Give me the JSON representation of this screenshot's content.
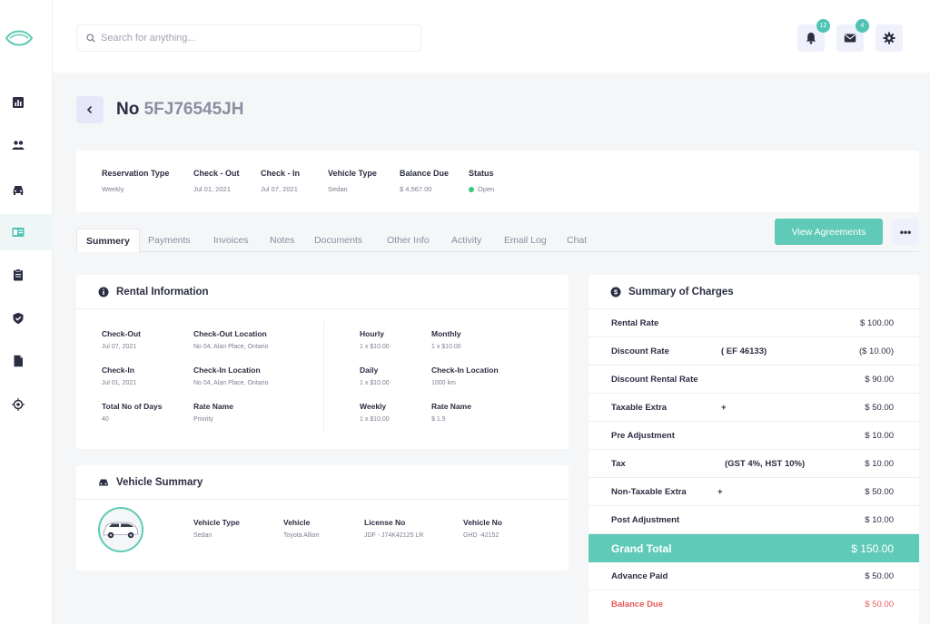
{
  "search": {
    "placeholder": "Search for anything..."
  },
  "notifications": {
    "bell_count": "12",
    "mail_count": "4"
  },
  "title": {
    "prefix": "No",
    "id": "5FJ76545JH"
  },
  "info": [
    {
      "label": "Reservation Type",
      "value": "Weekly"
    },
    {
      "label": "Check - Out",
      "value": "Jul 01, 2021"
    },
    {
      "label": "Check - In",
      "value": "Jul 07, 2021"
    },
    {
      "label": "Vehicle Type",
      "value": "Sedan"
    },
    {
      "label": "Balance Due",
      "value": "$ 4,567.00"
    },
    {
      "label": "Status",
      "value": "Open"
    }
  ],
  "tabs": [
    "Summery",
    "Payments",
    "Invoices",
    "Notes",
    "Documents",
    "Other Info",
    "Activity",
    "Email Log",
    "Chat"
  ],
  "actions": {
    "view_agreements": "View Agreements",
    "more": "•••"
  },
  "rental": {
    "title": "Rental Information",
    "fields": [
      {
        "label": "Check-Out",
        "value": "Jul 07, 2021"
      },
      {
        "label": "Check-Out Location",
        "value": "No 04, Alan Place, Ontario"
      },
      {
        "label": "Check-In",
        "value": "Jul 01, 2021"
      },
      {
        "label": "Check-In Location",
        "value": "No 04, Alan Place, Ontario"
      },
      {
        "label": "Total No of Days",
        "value": "40"
      },
      {
        "label": "Rate Name",
        "value": "Priority"
      },
      {
        "label": "Hourly",
        "value": "1 x $10.00"
      },
      {
        "label": "Monthly",
        "value": "1 x $10.00"
      },
      {
        "label": "Daily",
        "value": "1 x $10.00"
      },
      {
        "label": "Check-In Location",
        "value": "1000 km"
      },
      {
        "label": "Weekly",
        "value": "1 x $10.00"
      },
      {
        "label": "Rate Name",
        "value": "$ 1.5"
      }
    ]
  },
  "vehicle": {
    "title": "Vehicle Summary",
    "fields": [
      {
        "label": "Vehicle Type",
        "value": "Sedan"
      },
      {
        "label": "Vehicle",
        "value": "Toyota Allion"
      },
      {
        "label": "License No",
        "value": "JDF - J74K42125 LR"
      },
      {
        "label": "Vehicle No",
        "value": "GHD -42152"
      }
    ]
  },
  "charges": {
    "title": "Summary of Charges",
    "rows": [
      {
        "label": "Rental Rate",
        "mid": "",
        "amount": "$ 100.00"
      },
      {
        "label": "Discount Rate",
        "mid": "( EF 46133)",
        "amount": "($ 10.00)"
      },
      {
        "label": "Discount Rental Rate",
        "mid": "",
        "amount": "$ 90.00"
      },
      {
        "label": "Taxable Extra",
        "mid": "+",
        "amount": "$ 50.00"
      },
      {
        "label": "Pre Adjustment",
        "mid": "",
        "amount": "$ 10.00"
      },
      {
        "label": "Tax",
        "mid": "(GST 4%, HST 10%)",
        "amount": "$ 10.00"
      },
      {
        "label": "Non-Taxable Extra",
        "mid": "+",
        "amount": "$ 50.00"
      },
      {
        "label": "Post Adjustment",
        "mid": "",
        "amount": "$ 10.00"
      },
      {
        "label": "Grand Total",
        "mid": "",
        "amount": "$ 150.00"
      },
      {
        "label": "Advance Paid",
        "mid": "",
        "amount": "$ 50.00"
      },
      {
        "label": "Balance Due",
        "mid": "",
        "amount": "$ 50.00"
      }
    ]
  },
  "colors": {
    "accent": "#5fcab7",
    "danger": "#e85a5a",
    "status_open": "#3ec77a"
  }
}
